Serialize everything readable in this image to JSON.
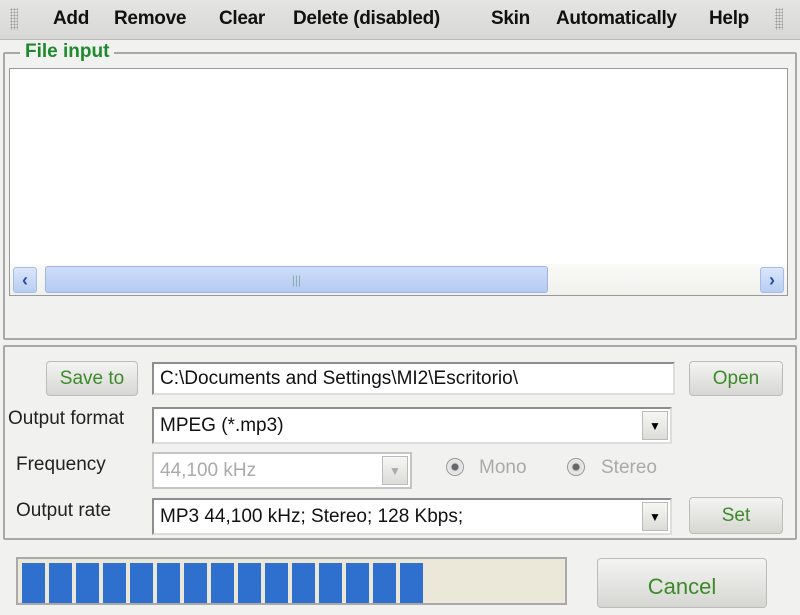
{
  "menu": {
    "items": [
      "Add",
      "Remove",
      "Clear",
      "Delete (disabled)",
      "Skin",
      "Automatically",
      "Help"
    ]
  },
  "file_input": {
    "legend": "File input",
    "files": []
  },
  "settings": {
    "save_to_label": "Save to",
    "save_path": "C:\\Documents and Settings\\MI2\\Escritorio\\",
    "open_label": "Open",
    "output_format_label": "Output format",
    "output_format_value": "MPEG (*.mp3)",
    "frequency_label": "Frequency",
    "frequency_value": "44,100 kHz",
    "mono_label": "Mono",
    "stereo_label": "Stereo",
    "output_rate_label": "Output rate",
    "output_rate_value": "MP3 44,100 kHz; Stereo;  128 Kbps;",
    "set_label": "Set"
  },
  "progress": {
    "percent": 73,
    "color": "#2f6fce"
  },
  "cancel_label": "Cancel"
}
